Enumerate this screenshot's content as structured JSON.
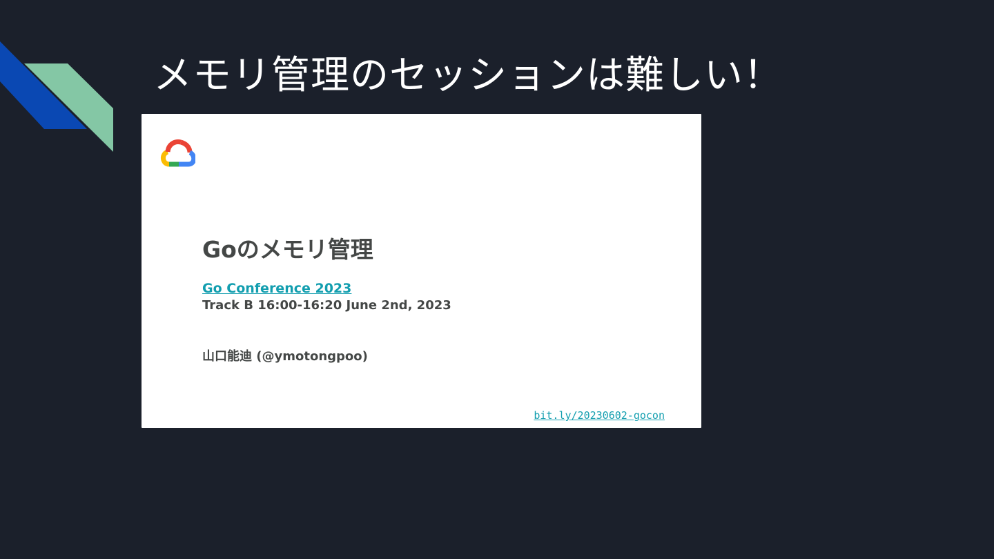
{
  "slide": {
    "title": "メモリ管理のセッションは難しい！",
    "background_color": "#1b202b",
    "accent_colors": [
      "#0a48b3",
      "#84c7a5"
    ]
  },
  "embedded_slide": {
    "logo_icon": "google-cloud-logo-icon",
    "title": "Goのメモリ管理",
    "conference_link": "Go Conference 2023",
    "track_info": "Track B 16:00-16:20 June 2nd, 2023",
    "speaker": "山口能迪 (@ymotongpoo)",
    "short_url": "bit.ly/20230602-gocon",
    "link_color": "#129eaf",
    "text_color": "#444746"
  }
}
